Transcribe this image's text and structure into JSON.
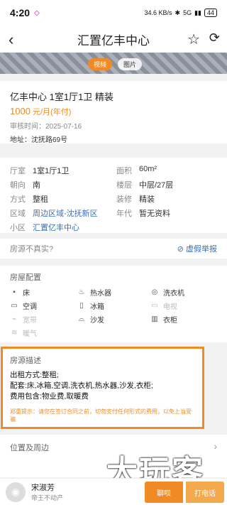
{
  "status_bar": {
    "time": "4:20",
    "net_speed": "34.6 KB/s",
    "signal": "5G",
    "battery": "44"
  },
  "nav": {
    "title": "汇置亿丰中心"
  },
  "media_tabs": [
    "视频",
    "图片"
  ],
  "listing": {
    "name": "亿丰中心 1室1厅1卫 精装",
    "price": "1000",
    "price_unit": "元/月(年付)",
    "review_label": "审核时间：",
    "review_date": "2025-07-16",
    "address_label": "地址：",
    "address": "沈抚路69号"
  },
  "details": [
    {
      "k": "厅室",
      "v": "1室1厅1卫",
      "link": false
    },
    {
      "k": "面积",
      "v": "60m²",
      "link": false
    },
    {
      "k": "朝向",
      "v": "南",
      "link": false
    },
    {
      "k": "楼层",
      "v": "中层/27层",
      "link": false
    },
    {
      "k": "方式",
      "v": "整租",
      "link": false
    },
    {
      "k": "装修",
      "v": "精装",
      "link": false
    },
    {
      "k": "区域",
      "v": "周边区域-沈抚新区",
      "link": true
    },
    {
      "k": "年代",
      "v": "暂无资料",
      "link": false
    },
    {
      "k": "小区",
      "v": "汇置亿丰中心",
      "link": true
    }
  ],
  "report": {
    "question": "房源不真实?",
    "button": "虚假举报"
  },
  "facilities": {
    "title": "房屋配置",
    "items": [
      {
        "label": "床",
        "icon": "bed-icon",
        "glyph": "▪",
        "available": true
      },
      {
        "label": "热水器",
        "icon": "water-heater-icon",
        "glyph": "♨",
        "available": true
      },
      {
        "label": "洗衣机",
        "icon": "washing-machine-icon",
        "glyph": "◎",
        "available": true
      },
      {
        "label": "空调",
        "icon": "air-conditioner-icon",
        "glyph": "▭",
        "available": true
      },
      {
        "label": "冰箱",
        "icon": "fridge-icon",
        "glyph": "▯",
        "available": true
      },
      {
        "label": "电视",
        "icon": "tv-icon",
        "glyph": "▭",
        "available": false
      },
      {
        "label": "宽带",
        "icon": "broadband-icon",
        "glyph": "⌁",
        "available": false
      },
      {
        "label": "沙发",
        "icon": "sofa-icon",
        "glyph": "⌓",
        "available": true
      },
      {
        "label": "衣柜",
        "icon": "wardrobe-icon",
        "glyph": "▥",
        "available": true
      },
      {
        "label": "暖气",
        "icon": "heater-icon",
        "glyph": "≋",
        "available": false
      }
    ]
  },
  "description": {
    "title": "房源描述",
    "lines": [
      "出租方式:整租;",
      "配套:床,冰箱,空调,洗衣机,热水器,沙发,衣柜;",
      "费用包含:物业费,取暖费"
    ],
    "tip": "郑重提示：请您在签订合同之前，切勿支付任何形式的费用，以免上当受骗"
  },
  "location": {
    "title": "位置及周边"
  },
  "agent": {
    "name": "宋淑芳",
    "company": "帝王不动产"
  },
  "actions": {
    "chat": "聊呗",
    "call": "打电话"
  },
  "watermark": "大玩客"
}
